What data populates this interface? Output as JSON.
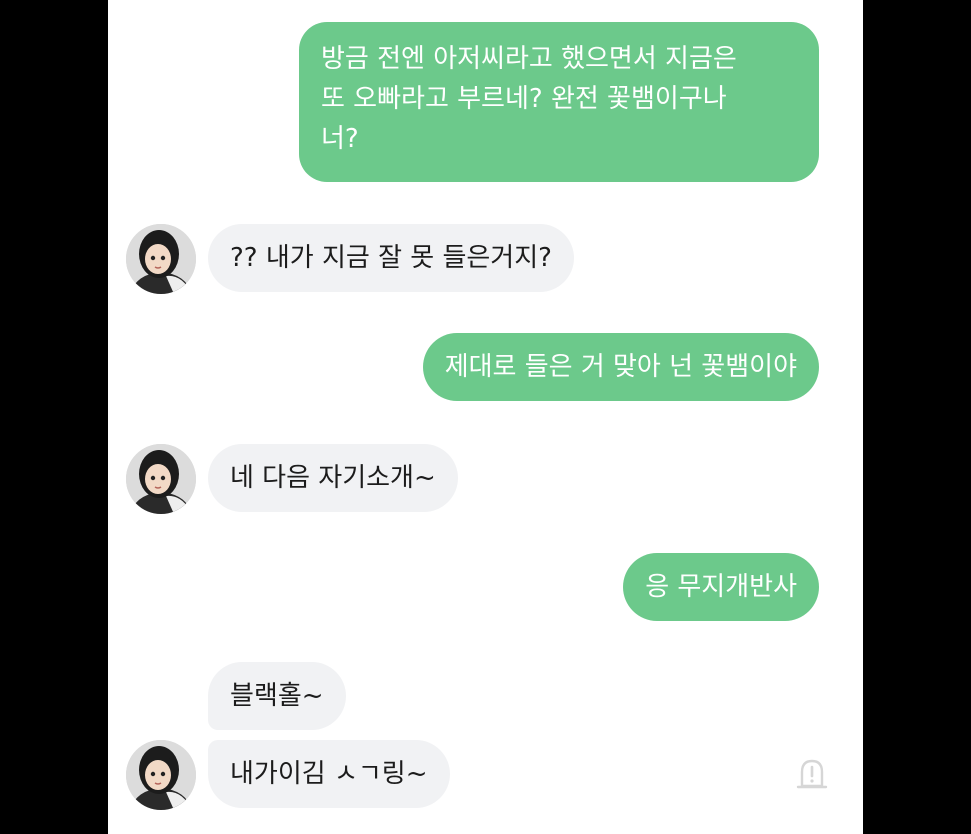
{
  "messages": [
    {
      "id": "m1",
      "sender": "me",
      "text_lines": [
        "방금 전엔 아저씨라고 했으면서 지금은",
        "또 오빠라고 부르네? 완전 꽃뱀이구나",
        "너?"
      ]
    },
    {
      "id": "m2",
      "sender": "other",
      "text": "?? 내가 지금 잘 못 들은거지?"
    },
    {
      "id": "m3",
      "sender": "me",
      "text": "제대로 들은 거 맞아 넌 꽃뱀이야"
    },
    {
      "id": "m4",
      "sender": "other",
      "text": "네 다음 자기소개~"
    },
    {
      "id": "m5",
      "sender": "me",
      "text": "응 무지개반사"
    },
    {
      "id": "m6",
      "sender": "other",
      "text": "블랙홀~"
    },
    {
      "id": "m7",
      "sender": "other",
      "text": "내가이김 ㅅㄱ링~"
    }
  ],
  "icons": {
    "avatar": "avatar-illustration",
    "report": "alert-siren-icon"
  },
  "colors": {
    "outgoing_bubble": "#6cc98b",
    "incoming_bubble": "#f1f2f4",
    "outgoing_text": "#ffffff",
    "incoming_text": "#1c1c1c",
    "frame": "#000000"
  }
}
